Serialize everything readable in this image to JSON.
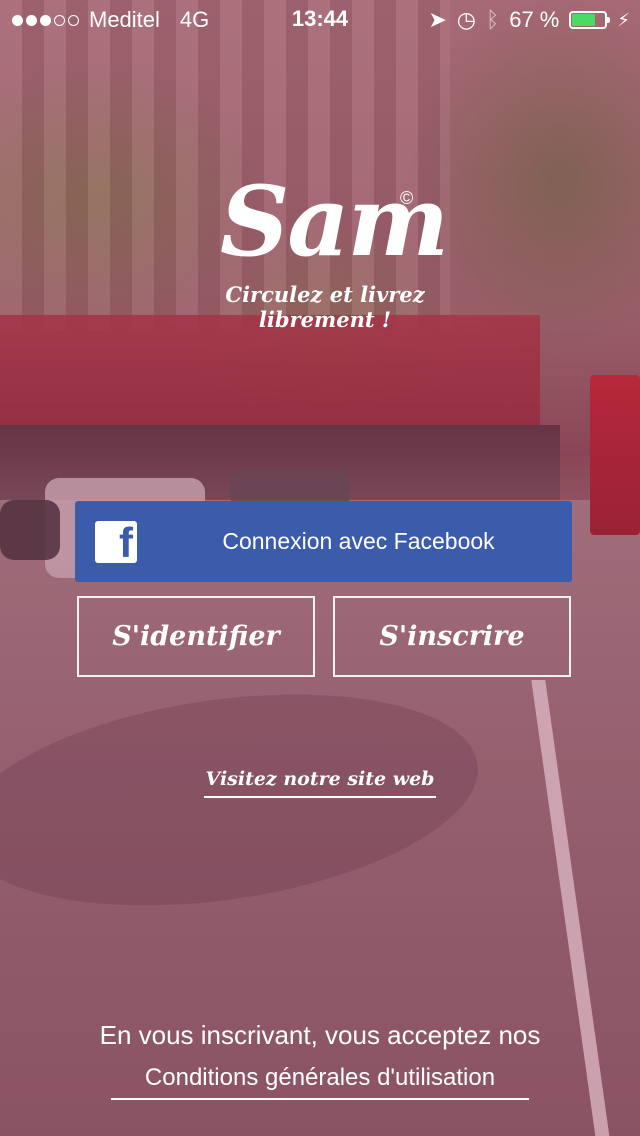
{
  "status_bar": {
    "carrier": "Meditel",
    "network": "4G",
    "time": "13:44",
    "battery_percent": "67 %",
    "battery_level": 0.67,
    "signal_bars_filled": 3,
    "signal_bars_total": 5
  },
  "logo": {
    "name": "Sam",
    "copyright": "©",
    "tagline": "Circulez et livrez librement !"
  },
  "buttons": {
    "facebook": "Connexion avec Facebook",
    "login": "S'identifier",
    "signup": "S'inscrire"
  },
  "links": {
    "website": "Visitez notre site web"
  },
  "terms": {
    "intro": "En vous inscrivant, vous acceptez nos",
    "link": "Conditions générales d'utilisation"
  },
  "colors": {
    "facebook_blue": "#3b5bab",
    "battery_green": "#4cd964",
    "overlay": "#8c3c5a"
  }
}
